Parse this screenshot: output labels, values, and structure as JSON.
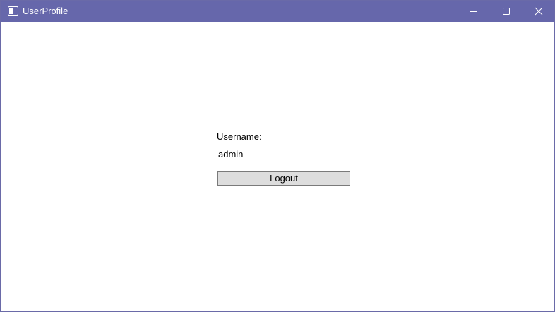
{
  "window": {
    "title": "UserProfile",
    "icon": "app-window-icon",
    "controls": {
      "minimize_icon": "minimize-icon",
      "maximize_icon": "maximize-icon",
      "close_icon": "close-icon"
    },
    "titlebar_color": "#6667ab"
  },
  "main": {
    "username_label": "Username:",
    "username_value": "admin",
    "logout_label": "Logout"
  }
}
